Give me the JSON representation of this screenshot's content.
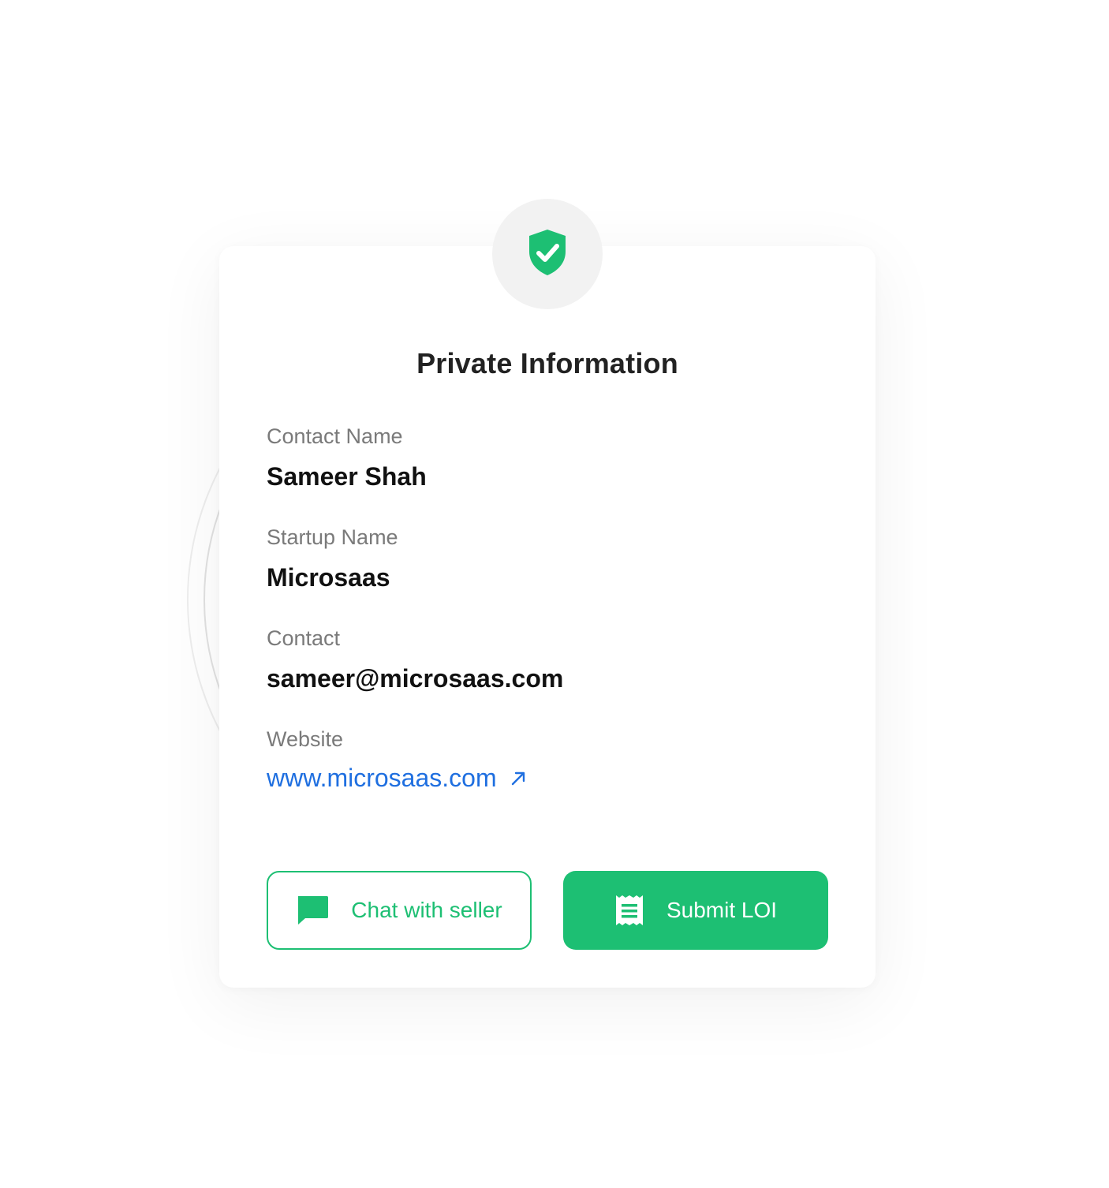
{
  "card": {
    "title": "Private Information"
  },
  "fields": [
    {
      "label": "Contact Name",
      "value": "Sameer Shah"
    },
    {
      "label": "Startup Name",
      "value": "Microsaas"
    },
    {
      "label": "Contact",
      "value": "sameer@microsaas.com"
    },
    {
      "label": "Website",
      "value": "www.microsaas.com"
    }
  ],
  "actions": {
    "chat_label": "Chat with seller",
    "submit_label": "Submit LOI"
  },
  "icons": {
    "badge": "shield-check-icon",
    "link": "external-link-arrow-icon",
    "chat": "chat-bubble-icon",
    "submit": "receipt-icon"
  },
  "colors": {
    "accent": "#1dbf73",
    "link": "#1f6fe0",
    "label": "#7a7a7a",
    "title": "#222222"
  }
}
